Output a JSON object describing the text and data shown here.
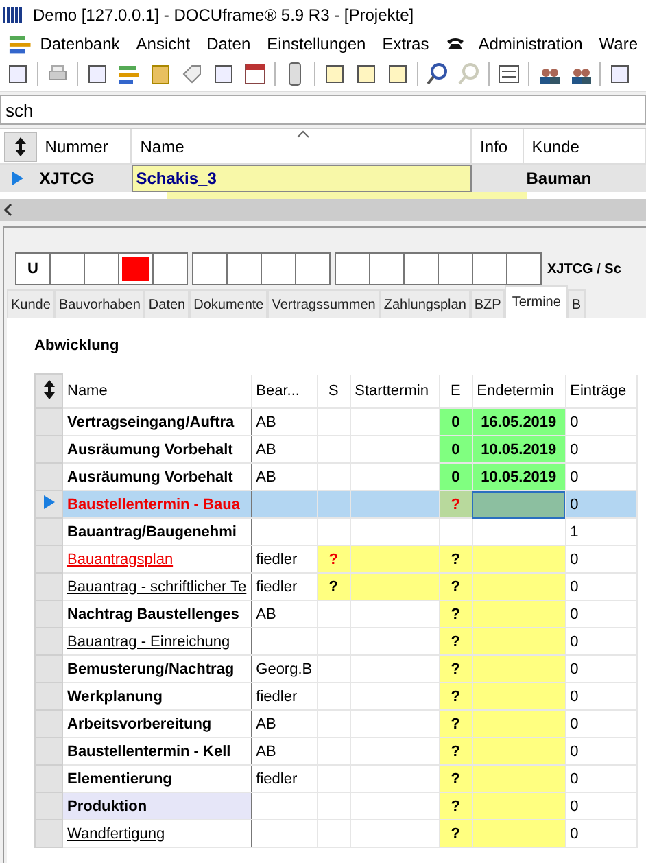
{
  "window": {
    "title": "Demo [127.0.0.1] - DOCUframe® 5.9 R3 - [Projekte]"
  },
  "menu": [
    {
      "label": "Datenbank"
    },
    {
      "label": "Ansicht"
    },
    {
      "label": "Daten"
    },
    {
      "label": "Einstellungen"
    },
    {
      "label": "Extras"
    },
    {
      "label": "Administration",
      "kind": "phone"
    },
    {
      "label": "Ware"
    }
  ],
  "search": {
    "value": "sch"
  },
  "project_grid": {
    "columns": [
      "Nummer",
      "Name",
      "Info",
      "Kunde"
    ],
    "rows": [
      {
        "nummer": "XJTCG",
        "name": "Schakis_3",
        "kunde": "Bauman",
        "selected": true
      }
    ]
  },
  "flags": [
    [
      {
        "label": "U",
        "on": false
      },
      {
        "on": false
      },
      {
        "on": false
      },
      {
        "on": true
      },
      {
        "on": false
      }
    ],
    [
      {
        "on": false
      },
      {
        "on": false
      },
      {
        "on": false
      },
      {
        "on": false
      }
    ],
    [
      {
        "on": false
      },
      {
        "on": false
      },
      {
        "on": false
      },
      {
        "on": false
      },
      {
        "on": false
      },
      {
        "on": false
      }
    ]
  ],
  "record_title": "XJTCG / Sc",
  "tabs": [
    {
      "label": "Kunde",
      "selected": false
    },
    {
      "label": "Bauvorhaben",
      "selected": false
    },
    {
      "label": "Daten",
      "selected": false
    },
    {
      "label": "Dokumente",
      "selected": false
    },
    {
      "label": "Vertragssummen",
      "selected": false
    },
    {
      "label": "Zahlungsplan",
      "selected": false
    },
    {
      "label": "BZP",
      "selected": false
    },
    {
      "label": "Termine",
      "selected": true
    },
    {
      "label": "B",
      "selected": false
    }
  ],
  "section_title": "Abwicklung",
  "table": {
    "columns": [
      "Name",
      "Bear...",
      "S",
      "Starttermin",
      "E",
      "Endetermin",
      "Einträge"
    ],
    "rows": [
      {
        "name": "Vertragseingang/Auftra",
        "kind": "bold",
        "bear": "AB",
        "start_open": false,
        "e": "0",
        "e_alert": false,
        "end_done": true,
        "ende": "16.05.2019",
        "count": "0",
        "selected": false
      },
      {
        "name": "Ausräumung Vorbehalt",
        "kind": "bold",
        "bear": "AB",
        "start_open": false,
        "e": "0",
        "e_alert": false,
        "end_done": true,
        "ende": "10.05.2019",
        "count": "0",
        "selected": false
      },
      {
        "name": "Ausräumung Vorbehalt",
        "kind": "bold",
        "bear": "AB",
        "start_open": false,
        "e": "0",
        "e_alert": false,
        "end_done": true,
        "ende": "10.05.2019",
        "count": "0",
        "selected": false
      },
      {
        "name": "Baustellentermin - Baua",
        "kind": "alert",
        "start_open": false,
        "e": "?",
        "e_alert": true,
        "end_open": true,
        "count": "0",
        "selected": true
      },
      {
        "name": "Bauantrag/Baugenehmi",
        "kind": "bold",
        "start_open": false,
        "end_open": false,
        "end_done": false,
        "count": "1",
        "selected": false
      },
      {
        "name": "Bauantragsplan",
        "kind": "link-alert",
        "bear": "fiedler",
        "s": "?",
        "s_alert": true,
        "start_open": true,
        "e": "?",
        "e_alert": false,
        "end_open": true,
        "count": "0",
        "selected": false
      },
      {
        "name": "Bauantrag - schriftlicher Te",
        "kind": "link",
        "bear": "fiedler",
        "s": "?",
        "s_alert": false,
        "start_open": true,
        "e": "?",
        "e_alert": false,
        "end_open": true,
        "count": "0",
        "selected": false
      },
      {
        "name": "Nachtrag Baustellenges",
        "kind": "bold",
        "bear": "AB",
        "start_open": false,
        "e": "?",
        "e_alert": false,
        "end_open": true,
        "count": "0",
        "selected": false
      },
      {
        "name": "Bauantrag - Einreichung",
        "kind": "link",
        "start_open": false,
        "e": "?",
        "e_alert": false,
        "end_open": true,
        "count": "0",
        "selected": false
      },
      {
        "name": "Bemusterung/Nachtrag",
        "kind": "bold",
        "bear": "Georg.B",
        "start_open": false,
        "e": "?",
        "e_alert": false,
        "end_open": true,
        "count": "0",
        "selected": false
      },
      {
        "name": "Werkplanung",
        "kind": "bold",
        "bear": "fiedler",
        "start_open": false,
        "e": "?",
        "e_alert": false,
        "end_open": true,
        "count": "0",
        "selected": false
      },
      {
        "name": "Arbeitsvorbereitung",
        "kind": "bold",
        "bear": "AB",
        "start_open": false,
        "e": "?",
        "e_alert": false,
        "end_open": true,
        "count": "0",
        "selected": false
      },
      {
        "name": "Baustellentermin - Kell",
        "kind": "bold",
        "bear": "AB",
        "start_open": false,
        "e": "?",
        "e_alert": false,
        "end_open": true,
        "count": "0",
        "selected": false
      },
      {
        "name": "Elementierung",
        "kind": "bold",
        "bear": "fiedler",
        "start_open": false,
        "e": "?",
        "e_alert": false,
        "end_open": true,
        "count": "0",
        "selected": false
      },
      {
        "name": "Produktion",
        "kind": "group",
        "start_open": false,
        "e": "?",
        "e_alert": false,
        "end_open": true,
        "count": "0",
        "selected": false
      },
      {
        "name": "Wandfertigung",
        "kind": "link",
        "start_open": false,
        "e": "?",
        "e_alert": false,
        "end_open": true,
        "count": "0",
        "selected": false
      }
    ]
  }
}
